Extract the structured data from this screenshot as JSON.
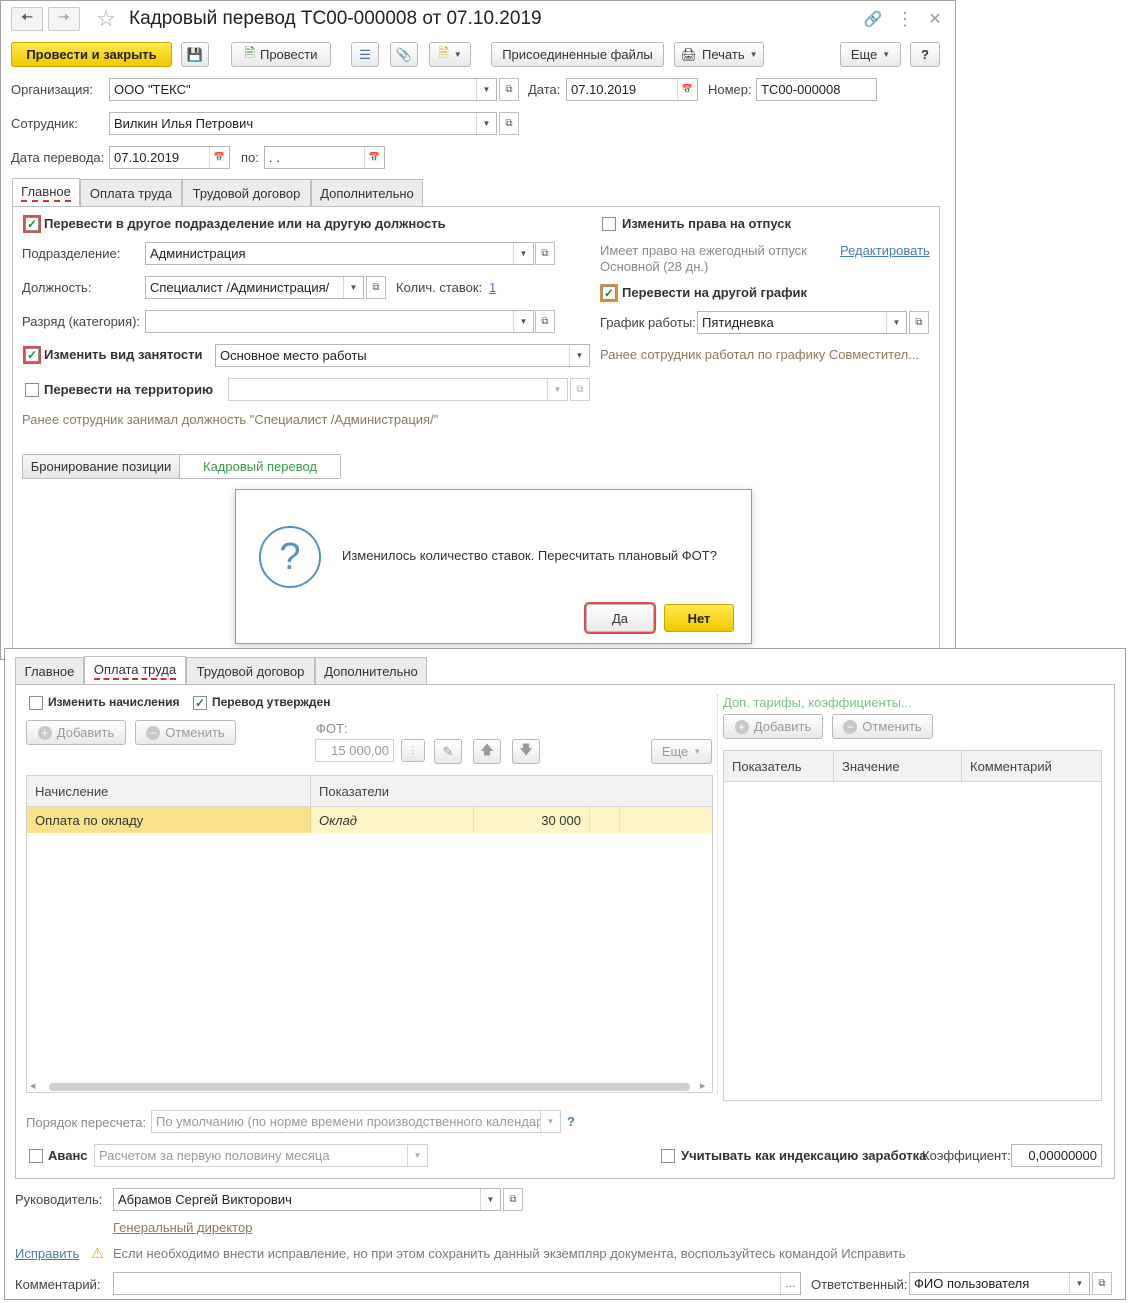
{
  "window1": {
    "title": "Кадровый перевод ТС00-000008 от 07.10.2019",
    "toolbar": {
      "post_close": "Провести и закрыть",
      "post": "Провести",
      "attached_files": "Присоединенные файлы",
      "print": "Печать",
      "more": "Еще",
      "help": "?"
    },
    "org_label": "Организация:",
    "org_value": "ООО \"ТЕКС\"",
    "date_label": "Дата:",
    "date_value": "07.10.2019",
    "number_label": "Номер:",
    "number_value": "ТС00-000008",
    "employee_label": "Сотрудник:",
    "employee_value": "Вилкин Илья Петрович",
    "transfer_date_label": "Дата перевода:",
    "transfer_date_value": "07.10.2019",
    "to_label": "по:",
    "to_value": " .  .",
    "tabs": [
      "Главное",
      "Оплата труда",
      "Трудовой договор",
      "Дополнительно"
    ],
    "main": {
      "transfer_dept_label": "Перевести в другое подразделение или на другую должность",
      "dept_label": "Подразделение:",
      "dept_value": "Администрация",
      "position_label": "Должность:",
      "position_value": "Специалист /Администрация/",
      "rates_label": "Колич. ставок:",
      "rates_value": "1",
      "grade_label": "Разряд (категория):",
      "grade_value": "",
      "employment_label": "Изменить вид занятости",
      "employment_value": "Основное место работы",
      "territory_label": "Перевести на территорию",
      "territory_value": "",
      "prev_position_hint": "Ранее сотрудник занимал должность \"Специалист /Администрация/\"",
      "vacation_label": "Изменить права на отпуск",
      "vacation_info_1": "Имеет право на ежегодный отпуск",
      "vacation_info_2": "Основной (28 дн.)",
      "edit_link": "Редактировать",
      "schedule_transfer_label": "Перевести на другой график",
      "schedule_label": "График работы:",
      "schedule_value": "Пятидневка",
      "prev_schedule_hint": "Ранее сотрудник работал по графику Совместител...",
      "seg_reserve": "Бронирование позиции",
      "seg_transfer": "Кадровый перевод"
    },
    "dialog": {
      "message": "Изменилось количество ставок. Пересчитать плановый ФОТ?",
      "yes": "Да",
      "no": "Нет"
    }
  },
  "window2": {
    "tabs": [
      "Главное",
      "Оплата труда",
      "Трудовой договор",
      "Дополнительно"
    ],
    "change_accruals_label": "Изменить начисления",
    "transfer_approved_label": "Перевод утвержден",
    "add": "Добавить",
    "cancel": "Отменить",
    "fot_label": "ФОТ:",
    "fot_value": "15 000,00",
    "more": "Еще",
    "grid": {
      "col_accrual": "Начисление",
      "col_indicators": "Показатели",
      "rows": [
        {
          "accrual": "Оплата по окладу",
          "indicator": "Оклад",
          "value": "30 000"
        }
      ]
    },
    "extra_tariffs": "Доп. тарифы, коэффициенты...",
    "right_grid": {
      "col_indicator": "Показатель",
      "col_value": "Значение",
      "col_comment": "Комментарий"
    },
    "recalc_label": "Порядок пересчета:",
    "recalc_value": "По умолчанию (по норме времени производственного календаря)",
    "help_q": "?",
    "advance_label": "Аванс",
    "advance_value": "Расчетом за первую половину месяца",
    "indexation_label": "Учитывать как индексацию заработка",
    "coef_label": "Коэффициент:",
    "coef_value": "0,00000000",
    "manager_label": "Руководитель:",
    "manager_value": "Абрамов Сергей Викторович",
    "manager_position": "Генеральный директор",
    "fix_link": "Исправить",
    "fix_hint": "Если необходимо внести исправление, но при этом сохранить данный экземпляр документа, воспользуйтесь командой Исправить",
    "comment_label": "Комментарий:",
    "responsible_label": "Ответственный:",
    "responsible_value": "ФИО пользователя"
  }
}
